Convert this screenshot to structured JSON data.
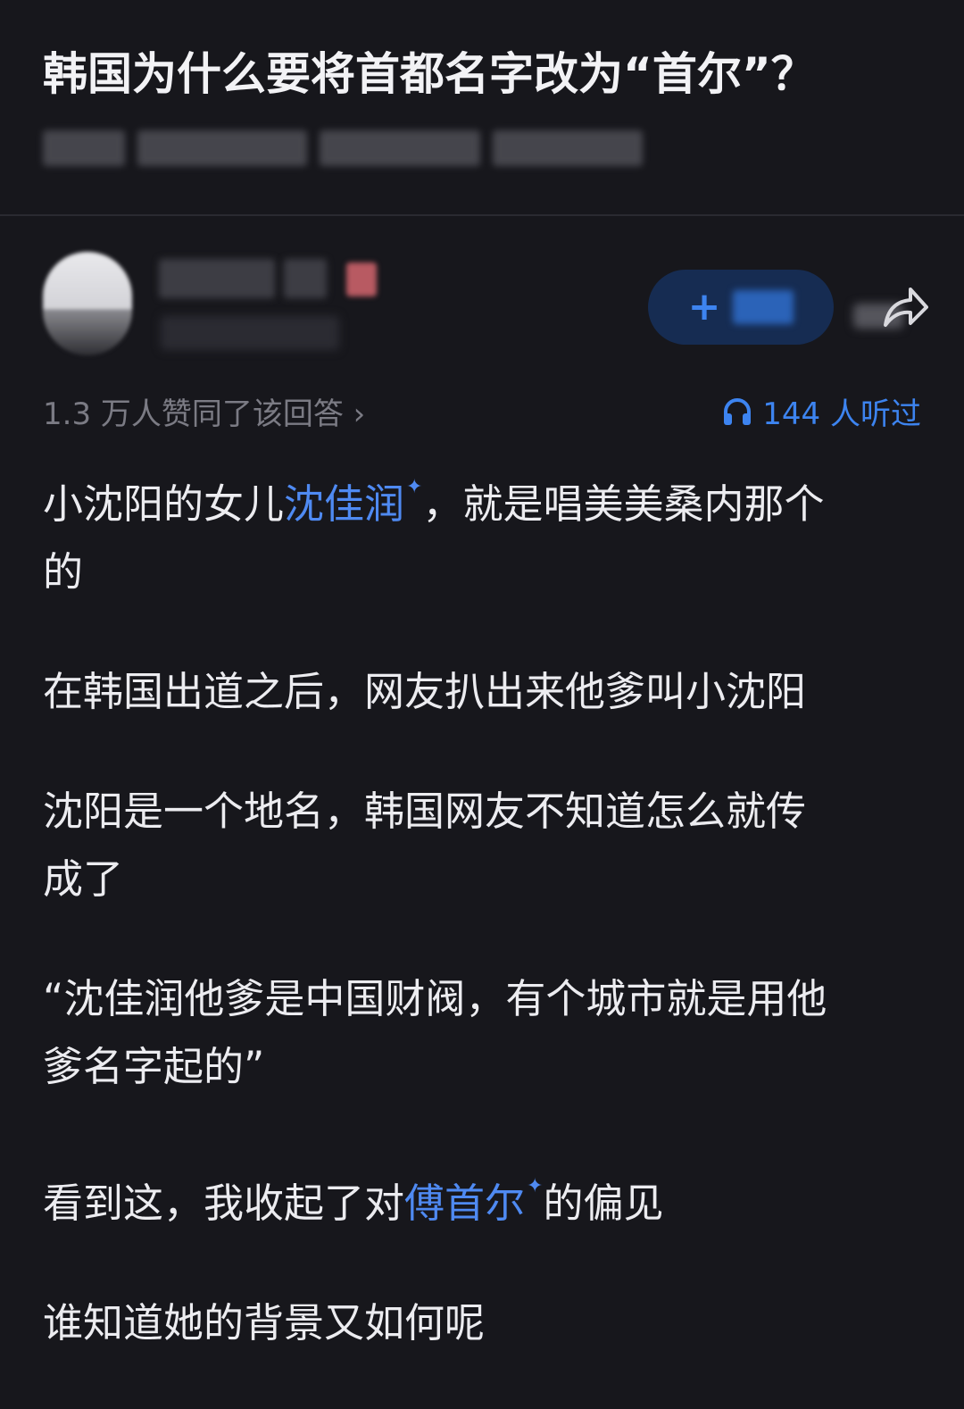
{
  "question": {
    "title": "韩国为什么要将首都名字改为“首尔”？"
  },
  "author": {
    "follow_plus": "+"
  },
  "meta": {
    "upvotes": "1.3 万人赞同了该回答 ›",
    "listened": "144 人听过"
  },
  "icons": {
    "headphones": "headphones-icon",
    "share": "share-icon",
    "sparkle": "sparkle-icon"
  },
  "colors": {
    "background": "#17171c",
    "text": "#ececf0",
    "muted": "#7b7b84",
    "link": "#4f8af2",
    "follow_bg": "#162c52"
  },
  "answer": {
    "p1_a": "小沈阳的女儿",
    "p1_link": "沈佳润",
    "p1_b": "，就是唱美美桑内那个",
    "p1_c": "的",
    "p2": "在韩国出道之后，网友扒出来他爹叫小沈阳",
    "p3_a": "沈阳是一个地名，韩国网友不知道怎么就传",
    "p3_b": "成了",
    "p4_a": "“沈佳润他爹是中国财阀，有个城市就是用他",
    "p4_b": "爹名字起的”",
    "p5_a": "看到这，我收起了对",
    "p5_link": "傅首尔",
    "p5_b": "的偏见",
    "p6": "谁知道她的背景又如何呢"
  }
}
